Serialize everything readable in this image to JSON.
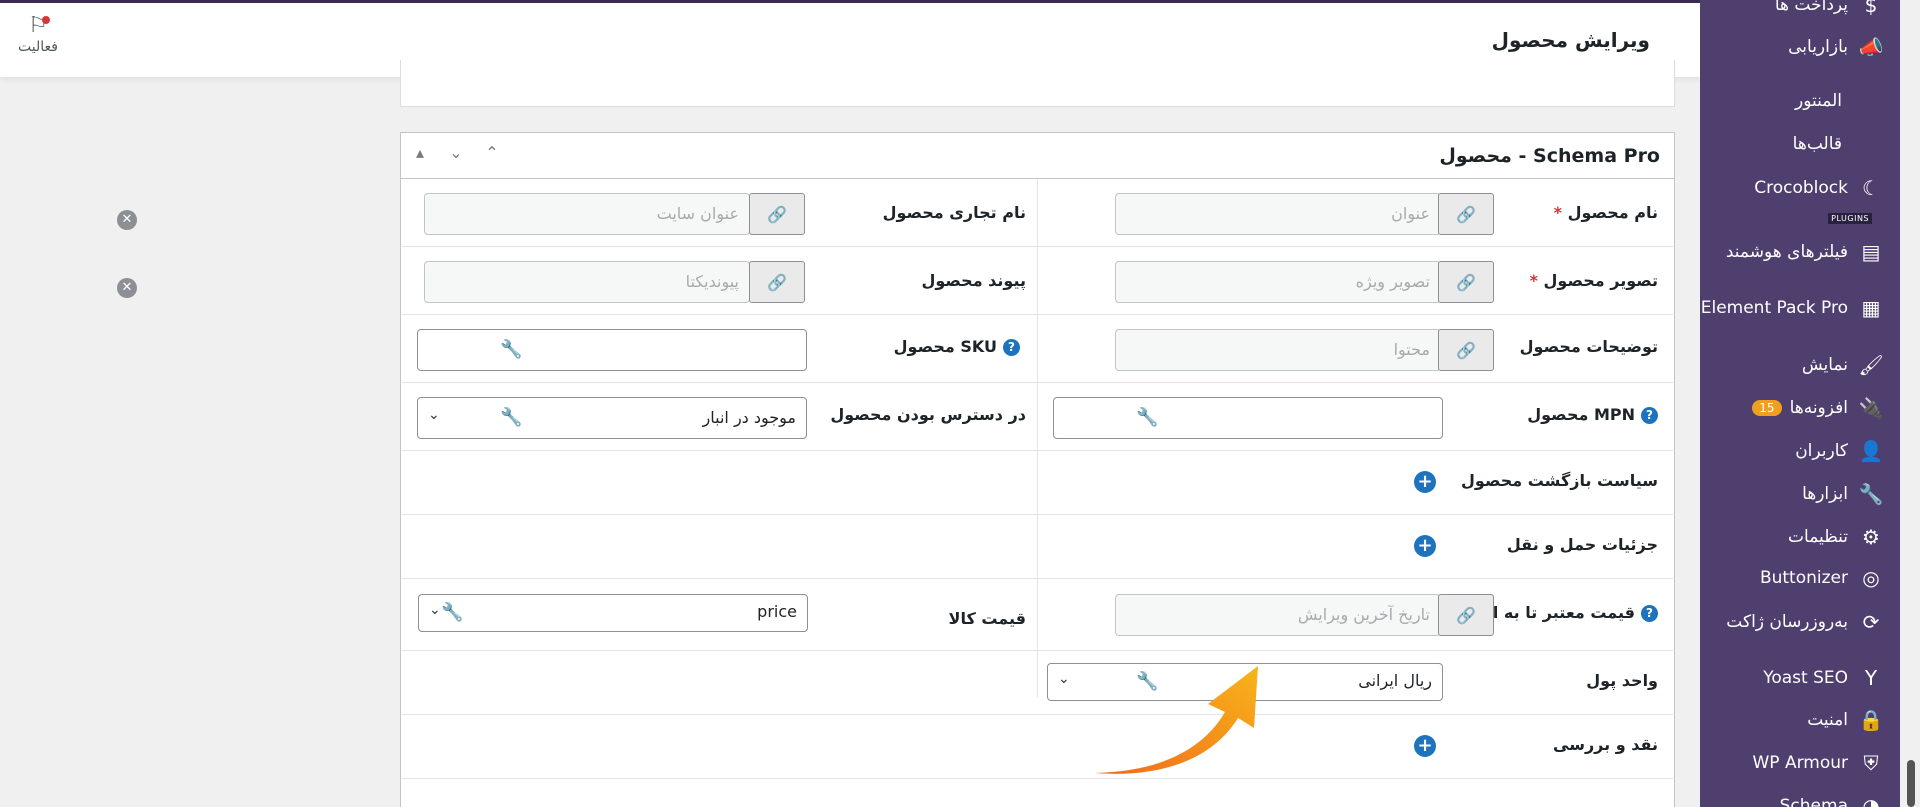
{
  "header": {
    "title": "ویرایش محصول",
    "activity_label": "فعالیت"
  },
  "sidebar": {
    "items": [
      {
        "label": "پرداخت ها",
        "icon": "dollar-icon"
      },
      {
        "label": "بازاریابی",
        "icon": "megaphone-icon"
      },
      {
        "label": "المنتور",
        "icon": ""
      },
      {
        "label": "قالب‌ها",
        "icon": ""
      },
      {
        "label": "Crocoblock",
        "icon": "crocoblock-icon"
      },
      {
        "label": "فیلترهای هوشمند",
        "icon": "filter-icon"
      },
      {
        "label": "Element Pack Pro",
        "icon": "element-pack-icon"
      },
      {
        "label": "نمایش",
        "icon": "brush-icon"
      },
      {
        "label": "افزونه‌ها",
        "icon": "plugin-icon",
        "badge": "15"
      },
      {
        "label": "کاربران",
        "icon": "user-icon"
      },
      {
        "label": "ابزارها",
        "icon": "wrench-icon"
      },
      {
        "label": "تنظیمات",
        "icon": "settings-icon"
      },
      {
        "label": "Buttonizer",
        "icon": "buttonizer-icon"
      },
      {
        "label": "به‌روزرسان ژاکت",
        "icon": "update-icon"
      },
      {
        "label": "Yoast SEO",
        "icon": "yoast-icon"
      },
      {
        "label": "امنیت",
        "icon": "lock-icon"
      },
      {
        "label": "WP Armour",
        "icon": "shield-icon"
      },
      {
        "label": "Schema",
        "icon": "schema-icon"
      }
    ],
    "plugins_tag": "PLUGINS"
  },
  "panel": {
    "title": "Schema Pro - محصول",
    "rows": {
      "product_name": {
        "label": "نام محصول",
        "placeholder": "عنوان"
      },
      "brand": {
        "label": "نام تجاری محصول",
        "placeholder": "عنوان سایت"
      },
      "product_image": {
        "label": "تصویر محصول",
        "placeholder": "تصویر ویژه"
      },
      "product_link": {
        "label": "پیوند محصول",
        "placeholder": "پیوندیکتا"
      },
      "description": {
        "label": "توضیحات محصول",
        "placeholder": "محتوا"
      },
      "sku": {
        "label": "SKU محصول"
      },
      "mpn": {
        "label": "MPN محصول"
      },
      "availability": {
        "label": "در دسترس بودن محصول",
        "value": "موجود در انبار"
      },
      "return_policy": {
        "label": "سیاست بازگشت محصول"
      },
      "shipping": {
        "label": "جزئیات حمل و نقل"
      },
      "price_valid": {
        "label": "قیمت معتبر تا به امروز",
        "placeholder": "تاریخ آخرین ویرایش"
      },
      "price": {
        "label": "قیمت کالا",
        "value": "price"
      },
      "currency": {
        "label": "واحد پول",
        "value": "ریال ایرانی"
      },
      "review": {
        "label": "نقد و بررسی"
      }
    }
  }
}
